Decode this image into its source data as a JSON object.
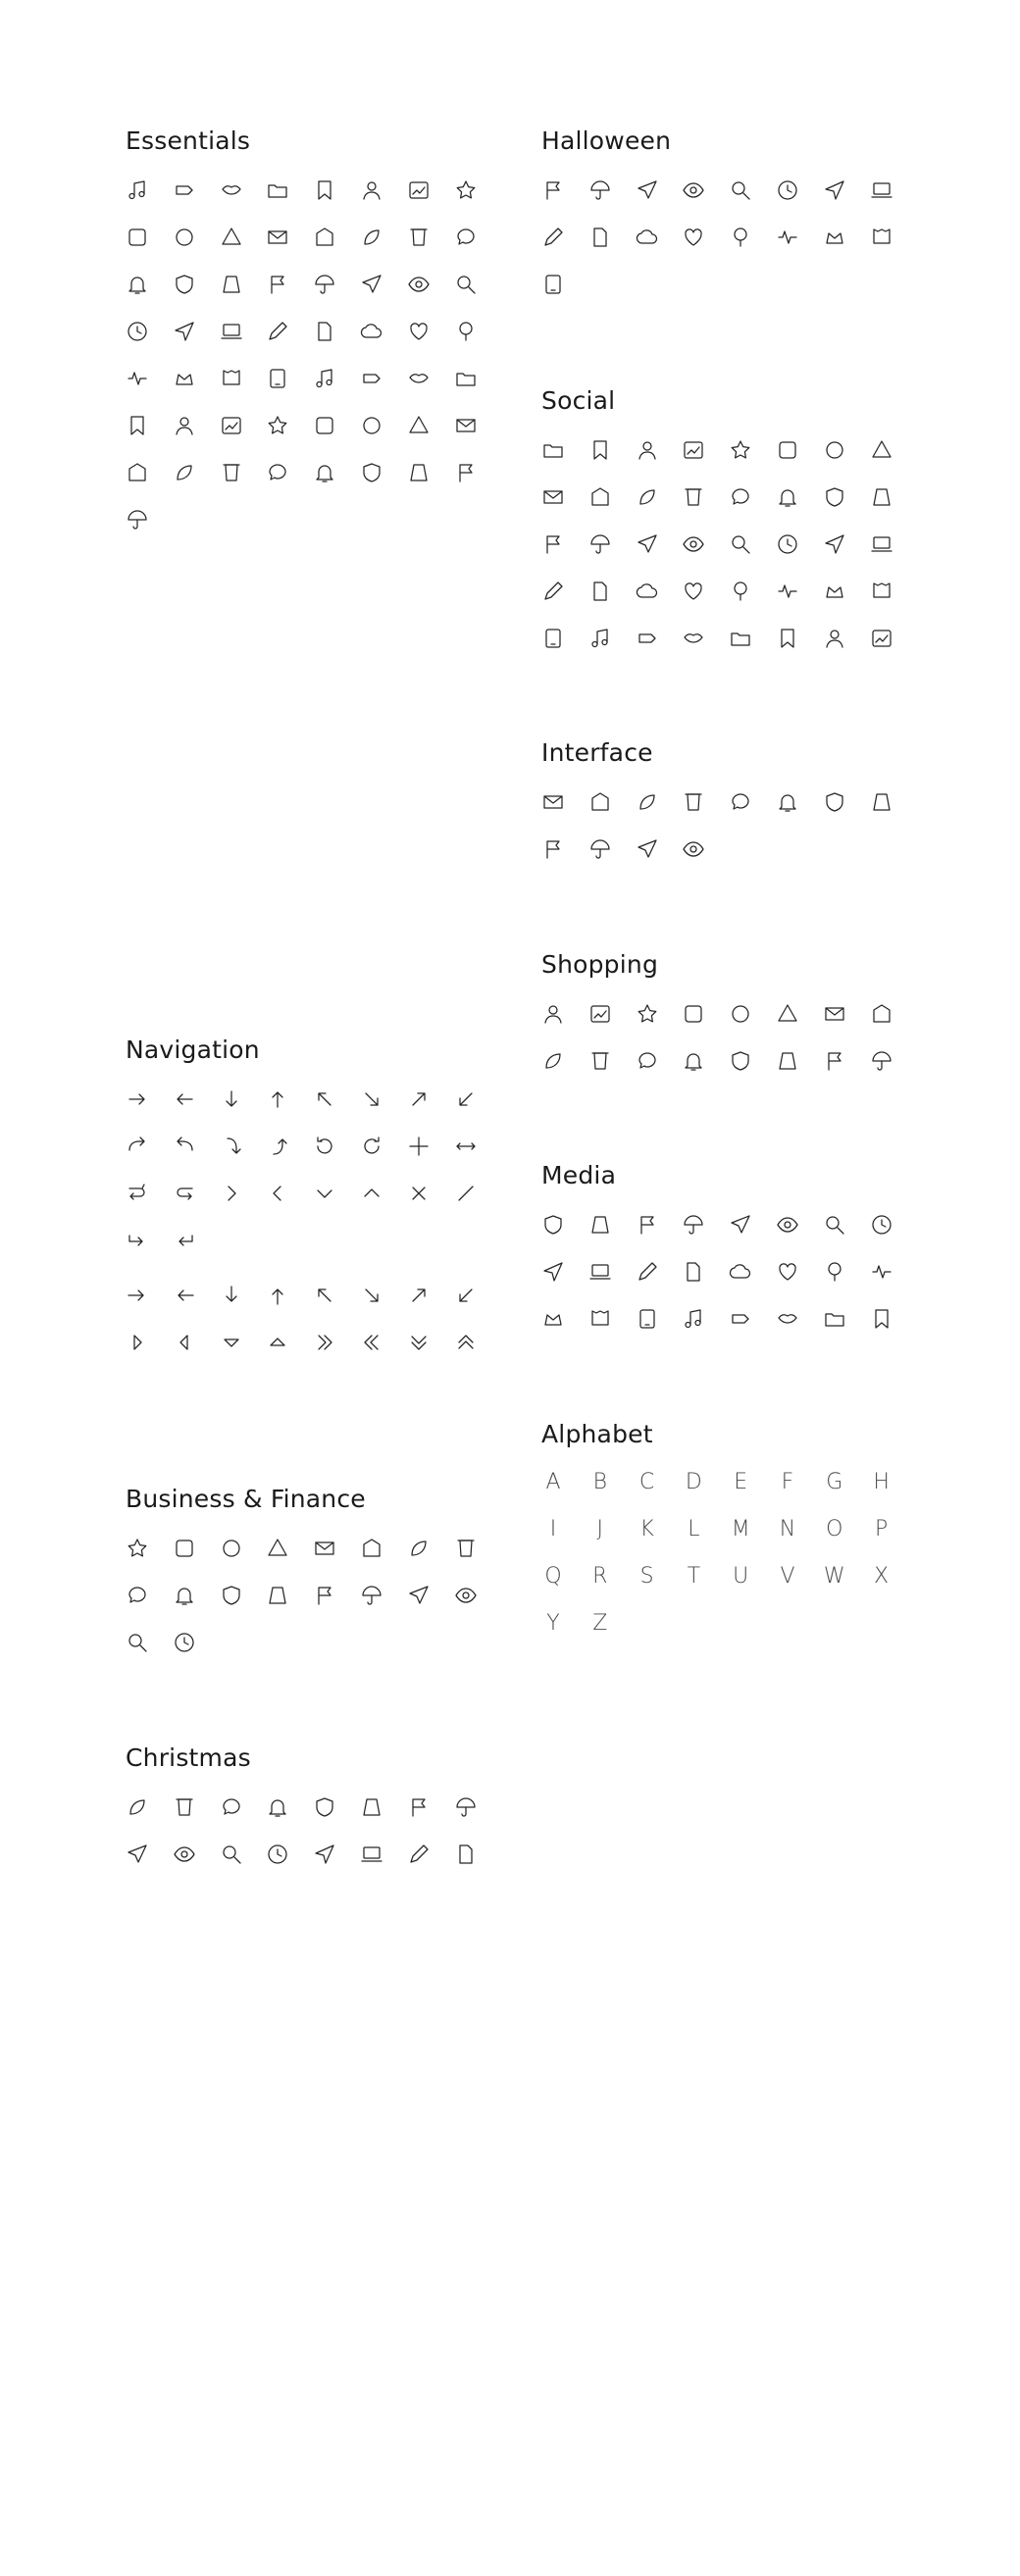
{
  "columns": {
    "left": [
      {
        "key": "essentials",
        "title": "Essentials",
        "count": 57
      },
      {
        "key": "navigation",
        "title": "Navigation",
        "count": 42
      },
      {
        "key": "business",
        "title": "Business & Finance",
        "count": 18
      },
      {
        "key": "christmas",
        "title": "Christmas",
        "count": 16
      }
    ],
    "right": [
      {
        "key": "halloween",
        "title": "Halloween",
        "count": 17
      },
      {
        "key": "social",
        "title": "Social",
        "count": 40
      },
      {
        "key": "interface",
        "title": "Interface",
        "count": 12
      },
      {
        "key": "shopping",
        "title": "Shopping",
        "count": 16
      },
      {
        "key": "media",
        "title": "Media",
        "count": 24
      },
      {
        "key": "alphabet",
        "title": "Alphabet",
        "letters": [
          "A",
          "B",
          "C",
          "D",
          "E",
          "F",
          "G",
          "H",
          "I",
          "J",
          "K",
          "L",
          "M",
          "N",
          "O",
          "P",
          "Q",
          "R",
          "S",
          "T",
          "U",
          "V",
          "W",
          "X",
          "Y",
          "Z"
        ]
      }
    ]
  },
  "icon_names": {
    "essentials": [
      "music-note-icon",
      "tag-icon",
      "lips-icon",
      "folder-icon",
      "bookmark-icon",
      "user-icon",
      "image-icon",
      "star-icon",
      "paint-roller-icon",
      "tablet-icon",
      "triangle-icon",
      "mail-icon",
      "medal-icon",
      "home-icon",
      "leaf-icon",
      "trash-icon",
      "chat-bubble-icon",
      "bell-icon",
      "shield-icon",
      "bucket-icon",
      "flag-icon",
      "umbrella-icon",
      "airplane-icon",
      "eye-icon",
      "magnifier-icon",
      "clock-icon",
      "send-icon",
      "laptop-icon",
      "pencil-icon",
      "document-icon",
      "cloud-icon",
      "heart-icon",
      "tree-icon",
      "house-icon",
      "crown-icon",
      "pulse-icon",
      "pin-icon",
      "t-shirt-icon",
      "hat-icon",
      "paperclip-icon",
      "bag-icon",
      "megaphone-icon",
      "thumbs-up-icon",
      "gear-icon",
      "cherries-icon",
      "apple-icon",
      "plant-icon",
      "pushpin-icon",
      "headset-icon",
      "hourglass-icon",
      "flower-icon",
      "play-icon",
      "book-icon",
      "bell-outline-icon",
      "bulb-icon",
      "database-icon"
    ],
    "navigation": [
      "arrow-right-icon",
      "arrow-left-icon",
      "arrow-down-icon",
      "arrow-up-icon",
      "arrow-up-left-icon",
      "arrow-down-right-icon",
      "arrow-up-right-icon",
      "arrow-down-left-icon",
      "curved-right-icon",
      "curved-left-icon",
      "curved-down-icon",
      "curved-up-icon",
      "rotate-left-icon",
      "rotate-right-icon",
      "move-icon",
      "resize-horizontal-icon",
      "return-right-icon",
      "return-left-icon",
      "chevron-right-icon",
      "chevron-left-icon",
      "chevron-down-icon",
      "chevron-up-icon",
      "close-icon",
      "diagonal-icon",
      "enter-right-icon",
      "enter-left-icon",
      "bold-arrow-right-icon",
      "bold-arrow-left-icon",
      "bold-arrow-down-icon",
      "bold-arrow-up-icon",
      "bold-arrow-up-left-icon",
      "bold-arrow-down-right-icon",
      "bold-arrow-up-right-icon",
      "bold-arrow-down-left-icon",
      "caret-right-icon",
      "caret-left-icon",
      "caret-down-icon",
      "caret-up-icon",
      "double-chevron-right-icon",
      "double-chevron-left-icon",
      "double-chevron-down-icon",
      "double-chevron-up-icon"
    ],
    "business": [
      "dollar-icon",
      "ethereum-icon",
      "euro-icon",
      "bitcoin-icon",
      "trend-up-icon",
      "briefcase-icon",
      "pie-chart-icon",
      "scale-icon",
      "credit-card-icon",
      "money-bag-icon",
      "wallet-icon",
      "coins-icon",
      "bar-chart-icon",
      "yen-icon",
      "bank-icon",
      "cash-icon",
      "sigma-icon",
      "receipt-icon"
    ],
    "christmas": [
      "christmas-tree-icon",
      "snow-globe-icon",
      "stocking-icon",
      "gift-card-icon",
      "ornament-icon",
      "bell-icon",
      "snowman-icon",
      "candle-icon",
      "candy-cane-icon",
      "gift-icon",
      "sleigh-icon",
      "gingerbread-icon",
      "snowflake-icon",
      "mitten-icon",
      "present-icon",
      "star-wand-icon"
    ],
    "halloween": [
      "witch-hat-icon",
      "ghost-icon",
      "bat-icon",
      "arrow-icon",
      "candy-icon",
      "bone-icon",
      "tombstone-icon",
      "broom-icon",
      "bell-icon",
      "speech-icon",
      "hand-icon",
      "pumpkin-icon",
      "cross-icon",
      "cat-icon",
      "owl-icon",
      "moon-icon",
      "cauldron-icon"
    ],
    "social": [
      "facebook-icon",
      "tiktok-icon",
      "youtube-icon",
      "telegram-icon",
      "instagram-icon",
      "slack-icon",
      "pinterest-icon",
      "tumblr-icon",
      "twitter-icon",
      "instagram-alt-icon",
      "discord-icon",
      "skype-icon",
      "snapchat-icon",
      "gmail-icon",
      "reddit-icon",
      "quora-icon",
      "linkedin-icon",
      "messenger-icon",
      "reddit-alt-icon",
      "paypal-icon",
      "google-icon",
      "trello-icon",
      "weibo-icon",
      "safari-icon",
      "spotify-icon",
      "notion-icon",
      "patreon-icon",
      "github-icon",
      "tinder-icon",
      "producthunt-icon",
      "apple-icon",
      "google-drive-icon",
      "netflix-icon",
      "whatsapp-icon",
      "dropbox-icon",
      "tidal-icon",
      "circles-icon",
      "wechat-icon",
      "chrome-icon",
      "vk-icon"
    ],
    "interface": [
      "card-icon",
      "bluetooth-icon",
      "toolbox-icon",
      "shield-icon",
      "crown-icon",
      "cloud-upload-icon",
      "download-tray-icon",
      "clock-icon",
      "check-icon",
      "bookmark-icon",
      "star-icon",
      "badge-icon"
    ],
    "shopping": [
      "basket-icon",
      "clipboard-icon",
      "cart-icon",
      "tag-icon",
      "percent-badge-icon",
      "receipt-icon",
      "bag-icon",
      "camera-icon",
      "store-icon",
      "stand-icon",
      "hanger-icon",
      "wallet-icon",
      "ticket-icon",
      "percent-icon",
      "gift-icon",
      "truck-icon"
    ],
    "media": [
      "headphones-icon",
      "microphone-icon",
      "speaker-icon",
      "film-icon",
      "camera-icon",
      "projector-icon",
      "shuffle-icon",
      "video-icon",
      "music-note-icon",
      "rewind-icon",
      "pause-icon",
      "play-icon",
      "fast-forward-icon",
      "broadcast-icon",
      "camera-icon",
      "radio-icon",
      "list-icon",
      "share-icon",
      "cloud-icon",
      "comment-icon",
      "photo-camera-icon",
      "record-icon",
      "tv-icon",
      "sparkle-icon"
    ],
    "alphabet": [
      "letter-icon"
    ]
  }
}
